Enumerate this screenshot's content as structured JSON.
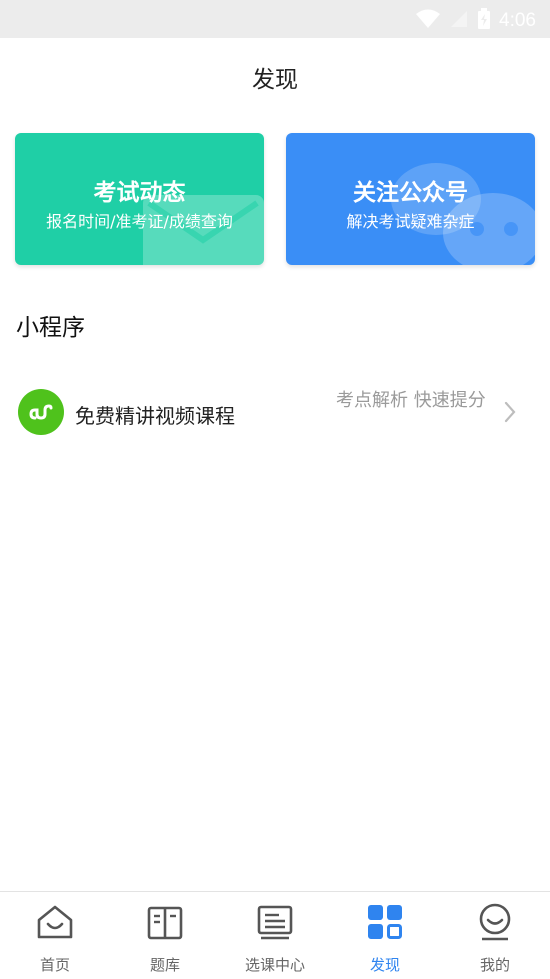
{
  "status_bar": {
    "time": "4:06"
  },
  "header": {
    "title": "发现"
  },
  "cards": [
    {
      "title": "考试动态",
      "subtitle": "报名时间/准考证/成绩查询",
      "color": "#1fcfa6"
    },
    {
      "title": "关注公众号",
      "subtitle": "解决考试疑难杂症",
      "color": "#3a8ef6"
    }
  ],
  "mini_programs": {
    "title": "小程序",
    "items": [
      {
        "label": "免费精讲视频课程",
        "description": "考点解析  快速提分",
        "icon": "link-icon"
      }
    ]
  },
  "tab_bar": {
    "active_color": "#2f84ef",
    "items": [
      {
        "label": "首页",
        "icon": "home-icon"
      },
      {
        "label": "题库",
        "icon": "book-icon"
      },
      {
        "label": "选课中心",
        "icon": "course-icon"
      },
      {
        "label": "发现",
        "icon": "discover-grid-icon",
        "active": true
      },
      {
        "label": "我的",
        "icon": "profile-icon"
      }
    ]
  }
}
